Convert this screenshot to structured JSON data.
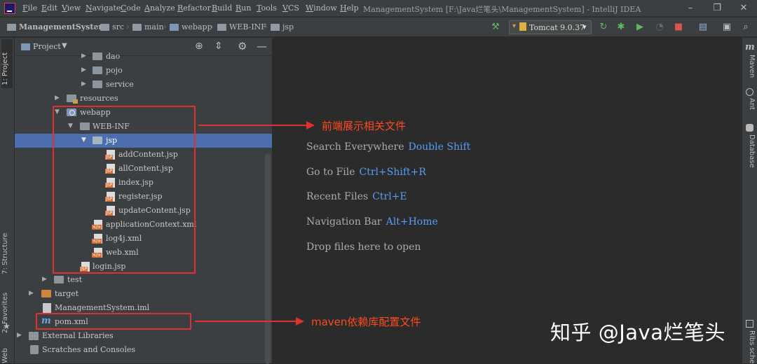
{
  "menu": [
    "File",
    "Edit",
    "View",
    "Navigate",
    "Code",
    "Analyze",
    "Refactor",
    "Build",
    "Run",
    "Tools",
    "VCS",
    "Window",
    "Help"
  ],
  "window_title": "ManagementSystem [F:\\Java烂笔头\\ManagementSystem] - IntelliJ IDEA",
  "breadcrumbs": [
    "ManagementSystem",
    "src",
    "main",
    "webapp",
    "WEB-INF",
    "jsp"
  ],
  "run_config": "Tomcat 9.0.37",
  "left_tabs": {
    "project": "1: Project",
    "structure": "7: Structure",
    "favorites": "2: Favorites",
    "web": "Web"
  },
  "right_tabs": {
    "maven": "Maven",
    "ant": "Ant",
    "database": "Database",
    "ribs": "Ribs sche"
  },
  "panel": {
    "title": "Project"
  },
  "tree": [
    {
      "label": "dao",
      "icon": "folder"
    },
    {
      "label": "pojo",
      "icon": "folder"
    },
    {
      "label": "service",
      "icon": "folder"
    },
    {
      "label": "resources",
      "icon": "res"
    },
    {
      "label": "webapp",
      "icon": "web"
    },
    {
      "label": "WEB-INF",
      "icon": "folder"
    },
    {
      "label": "jsp",
      "icon": "folder"
    },
    {
      "label": "addContent.jsp",
      "icon": "jsp"
    },
    {
      "label": "allContent.jsp",
      "icon": "jsp"
    },
    {
      "label": "index.jsp",
      "icon": "jsp"
    },
    {
      "label": "register.jsp",
      "icon": "jsp"
    },
    {
      "label": "updateContent.jsp",
      "icon": "jsp"
    },
    {
      "label": "applicationContext.xml",
      "icon": "xml"
    },
    {
      "label": "log4j.xml",
      "icon": "xml"
    },
    {
      "label": "web.xml",
      "icon": "xml"
    },
    {
      "label": "login.jsp",
      "icon": "jsp"
    },
    {
      "label": "test",
      "icon": "folder"
    },
    {
      "label": "target",
      "icon": "folder-orange"
    },
    {
      "label": "ManagementSystem.iml",
      "icon": "iml"
    },
    {
      "label": "pom.xml",
      "icon": "maven"
    },
    {
      "label": "External Libraries",
      "icon": "lib"
    },
    {
      "label": "Scratches and Consoles",
      "icon": "scratch"
    }
  ],
  "annotations": {
    "frontend": "前端展示相关文件",
    "maven": "maven依赖库配置文件"
  },
  "tips": [
    {
      "text": "Search Everywhere",
      "key": "Double Shift"
    },
    {
      "text": "Go to File",
      "key": "Ctrl+Shift+R"
    },
    {
      "text": "Recent Files",
      "key": "Ctrl+E"
    },
    {
      "text": "Navigation Bar",
      "key": "Alt+Home"
    },
    {
      "text": "Drop files here to open",
      "key": ""
    }
  ],
  "watermark": "知乎 @Java烂笔头",
  "colors": {
    "accent": "#589df6",
    "selection": "#4b6eaf",
    "annotation": "#e03030"
  }
}
